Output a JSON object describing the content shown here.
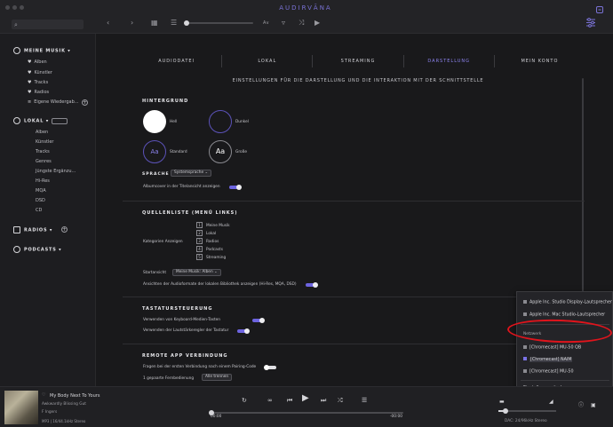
{
  "app": {
    "brand": "AUDIRVĀNA"
  },
  "search": {
    "placeholder": ""
  },
  "topbar": {
    "sort_label": "A∨"
  },
  "sidebar": {
    "my_music": {
      "title": "MEINE MUSIK",
      "items": [
        "Alben",
        "Künstler",
        "Tracks",
        "Radios",
        "Eigene Wiedergab..."
      ]
    },
    "local": {
      "title": "LOKAL",
      "items": [
        "Alben",
        "Künstler",
        "Tracks",
        "Genres",
        "Jüngste Ergänzu...",
        "Hi-Res",
        "MQA",
        "DSD",
        "CD"
      ]
    },
    "radios": "RADIOS",
    "podcasts": "PODCASTS"
  },
  "tabs": [
    {
      "label": "AUDIODATEI",
      "active": false
    },
    {
      "label": "LOKAL",
      "active": false
    },
    {
      "label": "STREAMING",
      "active": false
    },
    {
      "label": "DARSTELLUNG",
      "active": true
    },
    {
      "label": "MEIN KONTO",
      "active": false
    }
  ],
  "page_subtitle": "EINSTELLUNGEN FÜR DIE DARSTELLUNG UND DIE INTERAKTION MIT DER SCHNITTSTELLE",
  "background": {
    "title": "HINTERGRUND",
    "light": "Hell",
    "dark": "Dunkel",
    "standard": "Standard",
    "large": "Große",
    "aa": "Aa",
    "language_label": "SPRACHE",
    "language_value": "Systemsprache",
    "album_cover_label": "Albumcover in der Titelansicht anzeigen",
    "album_cover_on": true
  },
  "sources": {
    "title": "QUELLENLISTE (MENÜ LINKS)",
    "categories_label": "Kategorien Anzeigen",
    "categories": [
      {
        "num": "1",
        "label": "Meine Musik"
      },
      {
        "num": "2",
        "label": "Lokal"
      },
      {
        "num": "3",
        "label": "Radios"
      },
      {
        "num": "4",
        "label": "Podcasts"
      },
      {
        "num": "5",
        "label": "Streaming"
      }
    ],
    "start_view_label": "Startansicht",
    "start_view_value": "Meine Musik: Alben",
    "formats_label": "Ansichten der Audioformate der lokalen Bibliothek anzeigen (Hi-Res, MQA, DSD)",
    "formats_on": true
  },
  "keyboard": {
    "title": "TASTATURSTEUERUNG",
    "media_keys_label": "Verwenden von Keyboard-Medien-Tasten",
    "media_keys_on": true,
    "volume_keys_label": "Verwenden der Lautstärkeregler der Tastatur",
    "volume_keys_on": true
  },
  "remote": {
    "title": "REMOTE APP VERBINDUNG",
    "pairing_label": "Fragen bei der ersten Verbindung nach einem Pairing-Code",
    "pairing_on": false,
    "paired_label": "1 gepaarte Fernbedienung",
    "remove_all": "Alle trennen"
  },
  "output_popup": {
    "items_top": [
      "Apple Inc. Studio Display-Lautsprecher",
      "Apple Inc. Mac Studio-Lautsprecher"
    ],
    "network_header": "Netzwerk",
    "network_items": [
      {
        "label": "[Chromecast] MU-50 QB",
        "selected": false
      },
      {
        "label": "[Chromecast] NAIM",
        "selected": true
      },
      {
        "label": "[Chromecast] MU-50",
        "selected": false
      }
    ],
    "change_settings": "Einstellungen ändern"
  },
  "player": {
    "title": "My Body Next To Yours",
    "artist": "Awkwardly Blissing Gut",
    "album": "F Ingers",
    "format": "MP3 | 16/44.1kHz Stereo",
    "elapsed": "00:00",
    "remaining": "-00:00",
    "dac": "DAC: 24/96kHz Stereo",
    "volume": 0.12,
    "progress": 0.0
  },
  "colors": {
    "accent": "#7a72e6",
    "annotation": "#e0141c"
  }
}
